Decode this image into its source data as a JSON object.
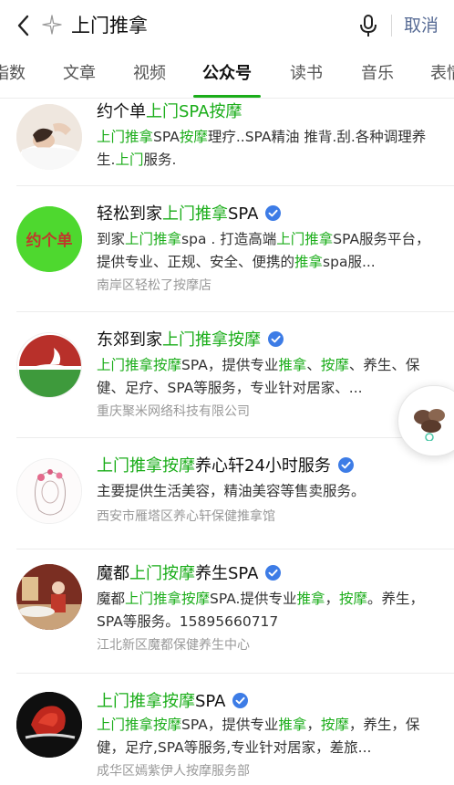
{
  "search": {
    "query": "上门推拿",
    "cancel_label": "取消"
  },
  "tabs": [
    {
      "label": "指数"
    },
    {
      "label": "文章"
    },
    {
      "label": "视频"
    },
    {
      "label": "公众号",
      "active": true
    },
    {
      "label": "读书"
    },
    {
      "label": "音乐"
    },
    {
      "label": "表情"
    }
  ],
  "colors": {
    "highlight": "#1aad19",
    "link": "#576b95",
    "verified": "#3d7ce6"
  },
  "results": [
    {
      "title_pre": "约个单",
      "title_hl": "上门SPA按摩",
      "title_post": "",
      "verified": false,
      "desc_parts": [
        {
          "t": "上门推拿",
          "hl": true
        },
        {
          "t": "SPA",
          "hl": false
        },
        {
          "t": "按摩",
          "hl": true
        },
        {
          "t": "理疗..SPA精油 推背.刮.各种调理养生.",
          "hl": false
        },
        {
          "t": "上门",
          "hl": true
        },
        {
          "t": "服务.",
          "hl": false
        }
      ],
      "sub": "",
      "avatar_icon": "massage-photo-icon"
    },
    {
      "title_pre": "轻松到家",
      "title_hl": "上门推拿",
      "title_post": "SPA",
      "verified": true,
      "desc_parts": [
        {
          "t": "到家",
          "hl": false
        },
        {
          "t": "上门推拿",
          "hl": true
        },
        {
          "t": "spa . 打造高端",
          "hl": false
        },
        {
          "t": "上门推拿",
          "hl": true
        },
        {
          "t": "SPA服务平台，提供专业、正规、安全、便携的",
          "hl": false
        },
        {
          "t": "推拿",
          "hl": true
        },
        {
          "t": "spa服...",
          "hl": false
        }
      ],
      "sub": "南岸区轻松了按摩店",
      "avatar_icon": "yuegedan-logo-icon",
      "avatar_text": "约个单"
    },
    {
      "title_pre": "东郊到家",
      "title_hl": "上门推拿按摩",
      "title_post": "",
      "verified": true,
      "desc_parts": [
        {
          "t": "上门推拿按摩",
          "hl": true
        },
        {
          "t": "SPA，提供专业",
          "hl": false
        },
        {
          "t": "推拿",
          "hl": true
        },
        {
          "t": "、",
          "hl": false
        },
        {
          "t": "按摩",
          "hl": true
        },
        {
          "t": "、养生、保健、足疗、SPA等服务，专业针对居家、...",
          "hl": false
        }
      ],
      "sub": "重庆聚米网络科技有限公司",
      "avatar_icon": "dongjiao-logo-icon"
    },
    {
      "title_pre": "",
      "title_hl": "上门推拿按摩",
      "title_post": "养心轩24小时服务",
      "verified": true,
      "desc_parts": [
        {
          "t": "主要提供生活美容，精油美容等售卖服务。",
          "hl": false
        }
      ],
      "sub": "西安市雁塔区养心轩保健推拿馆",
      "avatar_icon": "lady-sketch-icon"
    },
    {
      "title_pre": "魔都",
      "title_hl": "上门按摩",
      "title_post": "养生SPA",
      "verified": true,
      "desc_parts": [
        {
          "t": "魔都",
          "hl": false
        },
        {
          "t": "上门推拿按摩",
          "hl": true
        },
        {
          "t": "SPA.提供专业",
          "hl": false
        },
        {
          "t": "推拿",
          "hl": true
        },
        {
          "t": "，",
          "hl": false
        },
        {
          "t": "按摩",
          "hl": true
        },
        {
          "t": "。养生，SPA等服务。15895660717",
          "hl": false
        }
      ],
      "sub": "江北新区魔都保健养生中心",
      "avatar_icon": "spa-room-photo-icon"
    },
    {
      "title_pre": "",
      "title_hl": "上门推拿按摩",
      "title_post": "SPA",
      "verified": true,
      "desc_parts": [
        {
          "t": "上门推拿按摩",
          "hl": true
        },
        {
          "t": "SPA，提供专业",
          "hl": false
        },
        {
          "t": "推拿",
          "hl": true
        },
        {
          "t": "，",
          "hl": false
        },
        {
          "t": "按摩",
          "hl": true
        },
        {
          "t": "，养生，保健，足疗,SPA等服务,专业针对居家，差旅...",
          "hl": false
        }
      ],
      "sub": "成华区嫣紫伊人按摩服务部",
      "avatar_icon": "red-flower-photo-icon"
    }
  ]
}
